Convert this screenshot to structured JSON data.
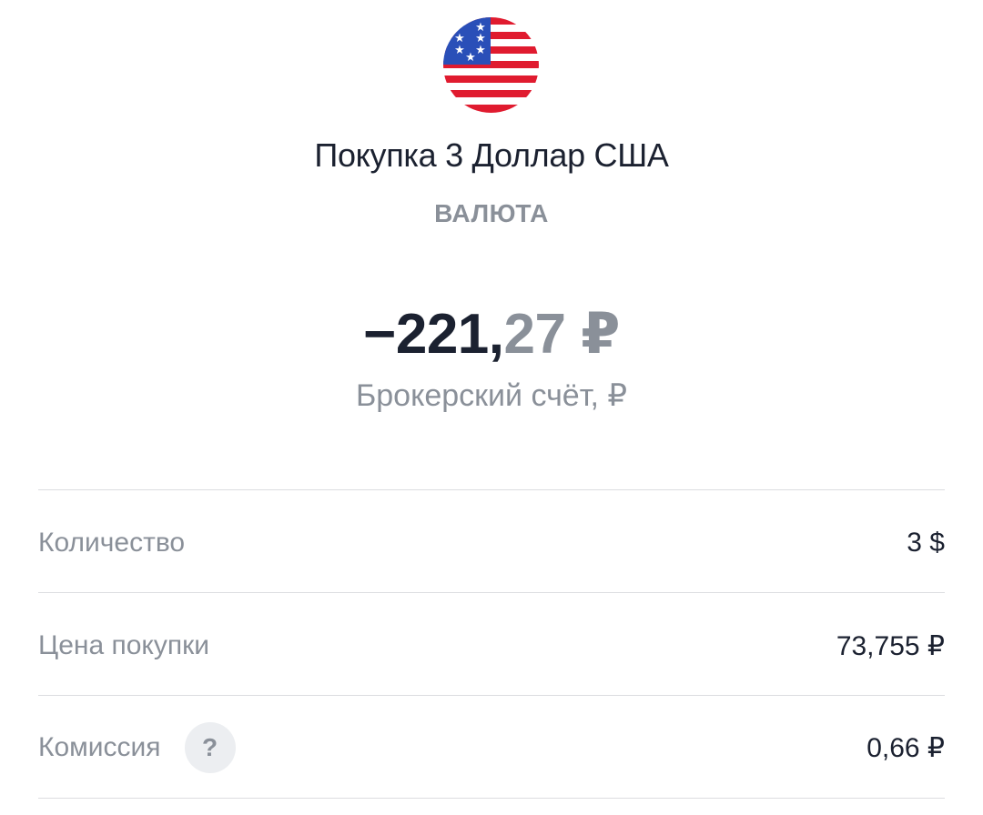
{
  "header": {
    "icon": "us-flag-icon",
    "title": "Покупка 3 Доллар США",
    "category": "ВАЛЮТА"
  },
  "amount": {
    "integer_part": "−221,",
    "fraction_part": "27 ₽",
    "account": "Брокерский счёт, ₽"
  },
  "details": {
    "quantity": {
      "label": "Количество",
      "value": "3 $"
    },
    "price": {
      "label": "Цена покупки",
      "value": "73,755 ₽"
    },
    "commission": {
      "label": "Комиссия",
      "help_glyph": "?",
      "value": "0,66 ₽"
    }
  },
  "colors": {
    "text_primary": "#1b2130",
    "text_secondary": "#8a9099",
    "divider": "#dcdde0",
    "flag_red": "#e01b2f",
    "flag_blue": "#2a4fb8"
  }
}
